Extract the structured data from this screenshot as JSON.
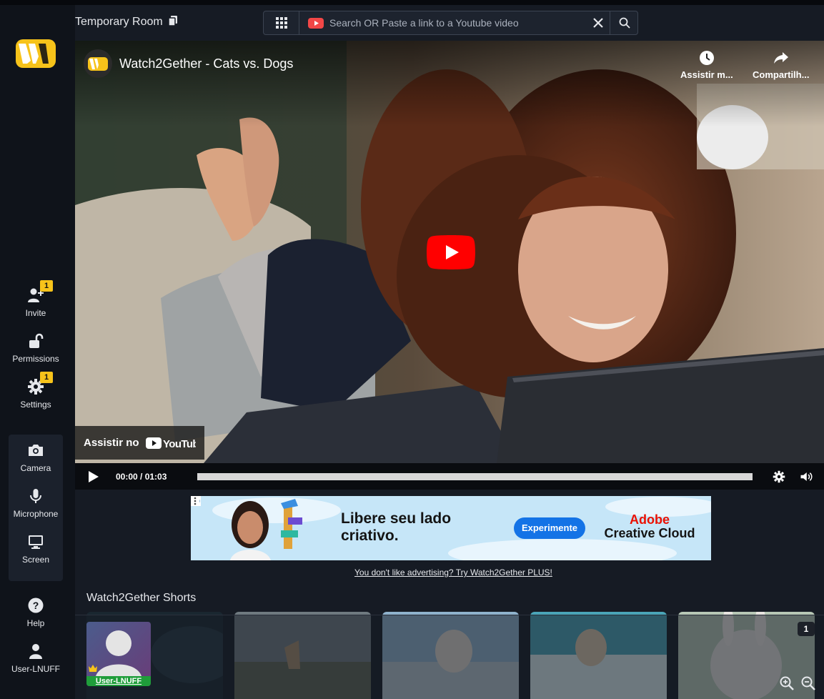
{
  "app": {
    "name": "Watch2Gether"
  },
  "room": {
    "title": "Temporary Room"
  },
  "search": {
    "placeholder": "Search OR Paste a link to a Youtube video"
  },
  "sidebar": {
    "items": [
      {
        "id": "invite",
        "label": "Invite",
        "icon": "user-plus-icon",
        "badge": "1"
      },
      {
        "id": "permissions",
        "label": "Permissions",
        "icon": "unlock-icon"
      },
      {
        "id": "settings",
        "label": "Settings",
        "icon": "gear-icon",
        "badge": "1"
      },
      {
        "id": "camera",
        "label": "Camera",
        "icon": "camera-icon"
      },
      {
        "id": "microphone",
        "label": "Microphone",
        "icon": "microphone-icon"
      },
      {
        "id": "screen",
        "label": "Screen",
        "icon": "monitor-icon"
      },
      {
        "id": "help",
        "label": "Help",
        "icon": "question-icon"
      },
      {
        "id": "user",
        "label": "User-LNUFF",
        "icon": "user-icon"
      }
    ]
  },
  "player": {
    "video_title": "Watch2Gether - Cats vs. Dogs",
    "watch_later_label": "Assistir m...",
    "share_label": "Compartilh...",
    "watch_on_label": "Assistir no",
    "youtube_label": "YouTube",
    "current_time": "00:00",
    "duration": "01:03",
    "time_display": "00:00 / 01:03",
    "progress": 0
  },
  "ad": {
    "headline": "Libere seu lado criativo.",
    "cta": "Experimente",
    "brand_top": "Adobe",
    "brand_bottom": "Creative Cloud"
  },
  "plus_link": "You don't like advertising? Try Watch2Gether PLUS!",
  "shorts": {
    "title": "Watch2Gether Shorts"
  },
  "user_tile": {
    "name": "User-LNUFF"
  },
  "participants_count": "1",
  "colors": {
    "accent_yellow": "#f7c31a",
    "youtube_red": "#ff0000",
    "user_green": "#1f9d3a",
    "sidebar_bg": "#0f131a"
  }
}
